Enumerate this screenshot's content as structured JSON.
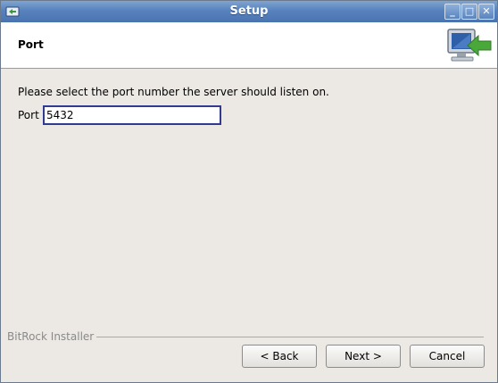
{
  "window": {
    "title": "Setup"
  },
  "header": {
    "title": "Port"
  },
  "content": {
    "prompt": "Please select the port number the server should listen on.",
    "port_label": "Port",
    "port_value": "5432"
  },
  "footer": {
    "brand": "BitRock Installer",
    "back_label": "< Back",
    "next_label": "Next >",
    "cancel_label": "Cancel"
  },
  "colors": {
    "titlebar": "#5782bd",
    "input_border": "#303a90"
  }
}
